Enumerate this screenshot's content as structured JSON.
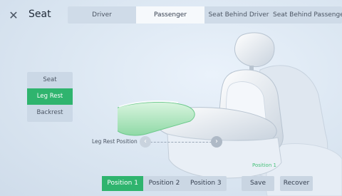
{
  "header": {
    "close_icon": "close-icon",
    "title": "Seat",
    "tabs": [
      {
        "label": "Driver",
        "active": false
      },
      {
        "label": "Passenger",
        "active": true
      },
      {
        "label": "Seat Behind Driver",
        "active": false
      },
      {
        "label": "Seat Behind Passenger",
        "active": false
      }
    ]
  },
  "side_menu": {
    "items": [
      {
        "label": "Seat",
        "active": false
      },
      {
        "label": "Leg Rest",
        "active": true
      },
      {
        "label": "Backrest",
        "active": false
      }
    ]
  },
  "slider": {
    "label": "Leg Rest Position",
    "left_icon": "chevron-left-icon",
    "right_icon": "chevron-right-icon"
  },
  "position_caption": "Position 1",
  "presets": [
    {
      "label": "Position 1",
      "active": true
    },
    {
      "label": "Position 2",
      "active": false
    },
    {
      "label": "Position 3",
      "active": false
    }
  ],
  "actions": {
    "save_label": "Save",
    "recover_label": "Recover"
  },
  "colors": {
    "accent": "#2fb46e",
    "highlight": "#46c17a"
  }
}
